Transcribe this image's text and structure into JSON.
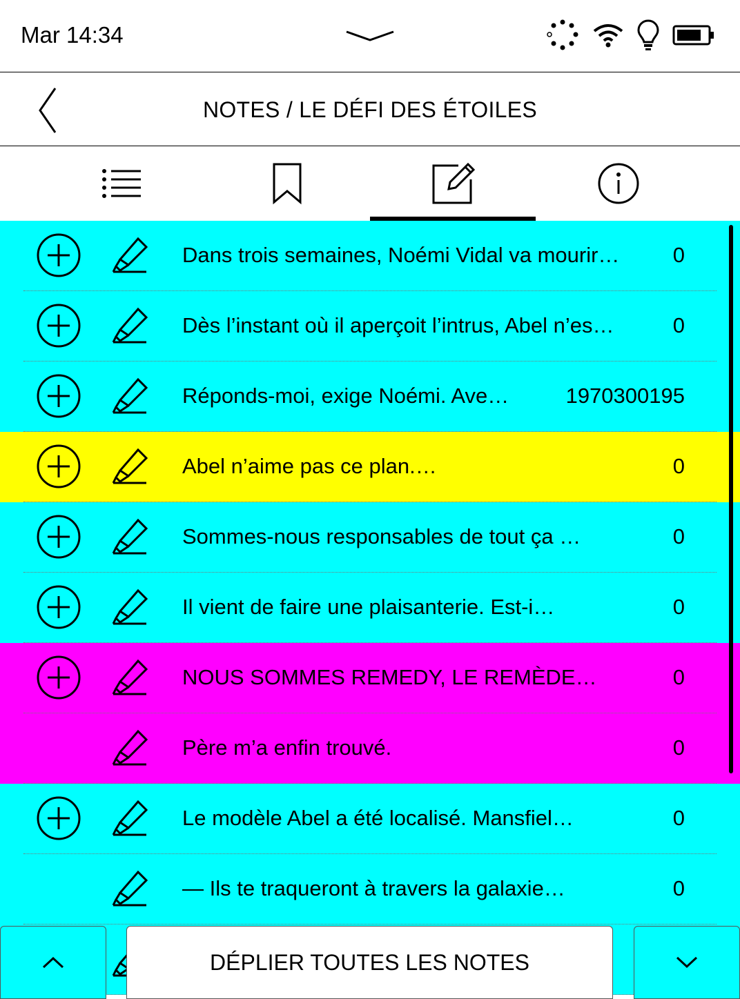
{
  "status": {
    "time": "Mar 14:34"
  },
  "header": {
    "title": "NOTES / LE DÉFI DES ÉTOILES"
  },
  "tabs": [
    {
      "icon": "list-icon"
    },
    {
      "icon": "bookmark-icon"
    },
    {
      "icon": "edit-note-icon",
      "active": true
    },
    {
      "icon": "info-icon"
    }
  ],
  "colors": {
    "cyan": "#00ffff",
    "yellow": "#ffff00",
    "magenta": "#ff00ff"
  },
  "notes": [
    {
      "text": "Dans trois semaines, Noémi Vidal va mourir…",
      "count": "0",
      "color": "#00ffff",
      "expandable": true
    },
    {
      "text": "Dès l’instant où il aperçoit l’intrus, Abel n’es…",
      "count": "0",
      "color": "#00ffff",
      "expandable": true
    },
    {
      "text": "Réponds-moi, exige Noémi. Ave…",
      "count": "1970300195",
      "color": "#00ffff",
      "expandable": true
    },
    {
      "text": "Abel n’aime pas ce plan.…",
      "count": "0",
      "color": "#ffff00",
      "expandable": true
    },
    {
      "text": "Sommes-nous responsables de tout ça …",
      "count": "0",
      "color": "#00ffff",
      "expandable": true
    },
    {
      "text": "Il vient de faire une plaisanterie. Est-i…",
      "count": "0",
      "color": "#00ffff",
      "expandable": true
    },
    {
      "text": "NOUS SOMMES REMEDY, LE REMÈDE…",
      "count": "0",
      "color": "#ff00ff",
      "expandable": true
    },
    {
      "text": "Père m’a enfin trouvé.",
      "count": "0",
      "color": "#ff00ff",
      "expandable": false
    },
    {
      "text": "Le modèle Abel a été localisé. Mansfiel…",
      "count": "0",
      "color": "#00ffff",
      "expandable": true
    },
    {
      "text": "— Ils te traqueront à travers la galaxie…",
      "count": "0",
      "color": "#00ffff",
      "expandable": false
    },
    {
      "text": "",
      "count": "0",
      "color": "#00ffff",
      "expandable": false
    }
  ],
  "bottom": {
    "expand_label": "DÉPLIER TOUTES LES NOTES"
  }
}
